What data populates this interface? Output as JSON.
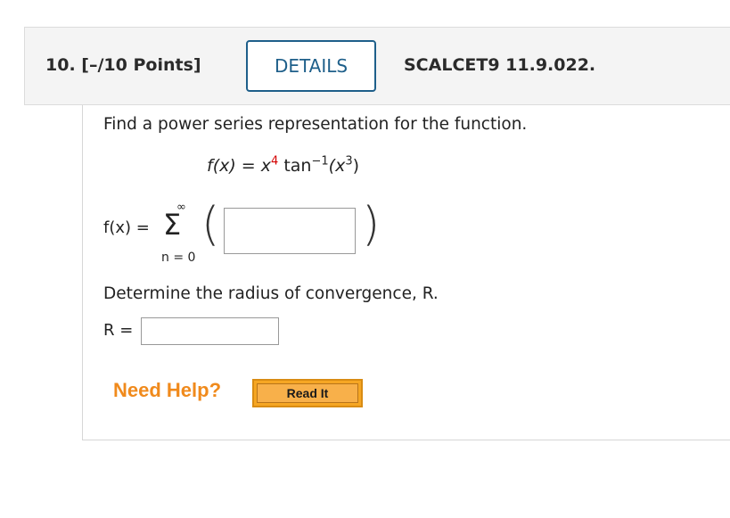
{
  "question": {
    "number": "10.",
    "points": "[–/10 Points]",
    "details_label": "DETAILS",
    "source": "SCALCET9 11.9.022."
  },
  "problem": {
    "prompt": "Find a power series representation for the function.",
    "func_lhs": "f(x) = x",
    "func_exp": "4",
    "func_mid": " tan",
    "func_inv": "−1",
    "func_arg": "(x",
    "func_arg_exp": "3",
    "func_close": ")",
    "series_lhs": "f(x) =",
    "sum_upper": "∞",
    "sum_symbol": "Σ",
    "sum_lower": "n = 0",
    "series_answer_value": "",
    "radius_prompt": "Determine the radius of convergence, R.",
    "radius_label": "R =",
    "radius_value": ""
  },
  "help": {
    "need_help": "Need Help?",
    "read_it": "Read It"
  },
  "colors": {
    "details_border": "#1e5f8a",
    "need_help": "#f08a1c",
    "read_it_bg": "#f6a623",
    "exponent_highlight": "#d40000"
  }
}
